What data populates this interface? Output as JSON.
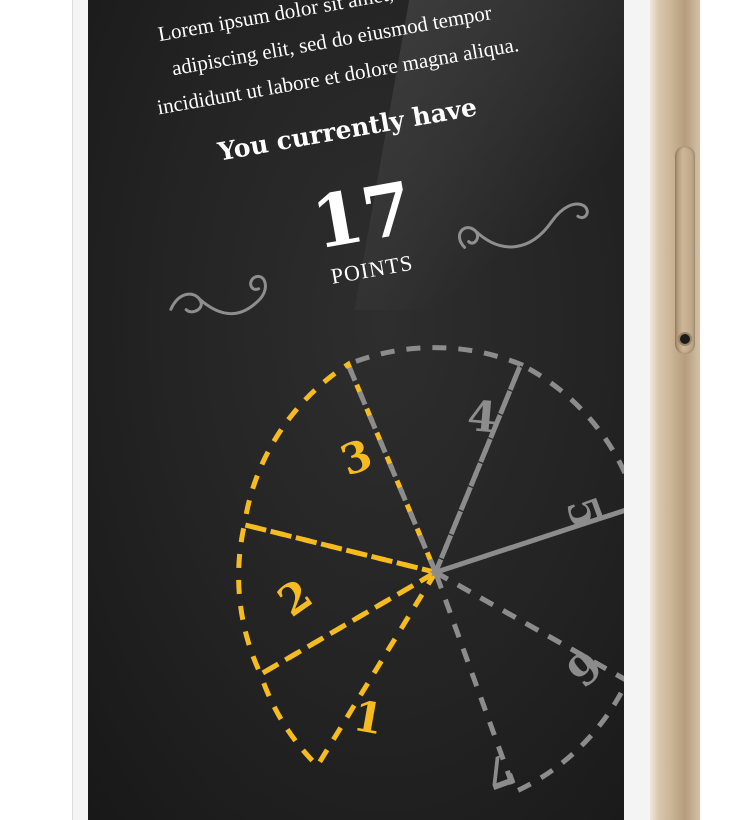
{
  "intro_lines": [
    "Lorem ipsum dolor sit amet, consectetur",
    "adipiscing elit, sed do eiusmod tempor",
    "incididunt ut labore et dolore magna aliqua."
  ],
  "headline": "You currently have",
  "points_value": "17",
  "points_label": "POINTS",
  "wheel_segments": [
    "1",
    "2",
    "3",
    "4",
    "5",
    "6",
    "7"
  ],
  "colors": {
    "active": "#f5bb1f",
    "inactive": "#8c8c8c",
    "screen": "#232323",
    "frame": "#c9b393"
  },
  "icons": [
    "flourish-left-icon",
    "flourish-right-icon"
  ]
}
